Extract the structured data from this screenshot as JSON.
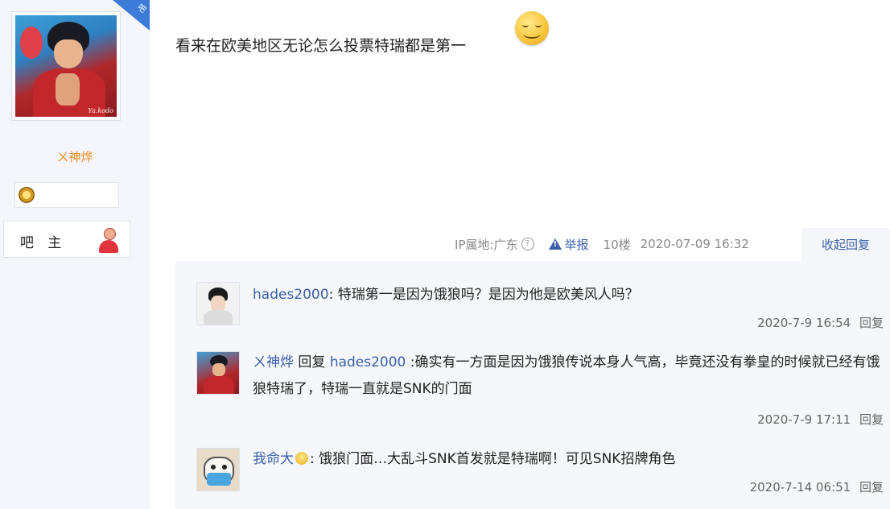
{
  "author": {
    "username": "ㄨ神烨",
    "corner_badge": "吧",
    "role_label": "吧 主",
    "avatar_signature": "Ya.kodo"
  },
  "post": {
    "text": "看来在欧美地区无论怎么投票特瑞都是第一",
    "emoji": "smiley-face",
    "ip_location": "IP属地:广东",
    "help_glyph": "?",
    "report_label": "举报",
    "floor": "10楼",
    "datetime": "2020-07-09 16:32",
    "collapse_label": "收起回复"
  },
  "replies": [
    {
      "user": "hades2000",
      "sep": ":",
      "text": " 特瑞第一是因为饿狼吗？是因为他是欧美风人吗？",
      "time": "2020-7-9 16:54",
      "reply_label": "回复"
    },
    {
      "user": "ㄨ神烨",
      "reply_kw": " 回复 ",
      "target": "hades2000",
      "sep": " :",
      "text": "确实有一方面是因为饿狼传说本身人气高，毕竟还没有拳皇的时候就已经有饿狼特瑞了，特瑞一直就是SNK的门面",
      "time": "2020-7-9 17:11",
      "reply_label": "回复"
    },
    {
      "user": "我命大",
      "sep": ":",
      "text": " 饿狼门面…大乱斗SNK首发就是特瑞啊！可见SNK招牌角色",
      "time": "2020-7-14 06:51",
      "reply_label": "回复"
    }
  ],
  "colors": {
    "link_blue": "#3a5fa8",
    "username_orange": "#f08a1c",
    "sidebar_bg": "#f4f6fb",
    "reply_bg": "#f5f7fb"
  }
}
